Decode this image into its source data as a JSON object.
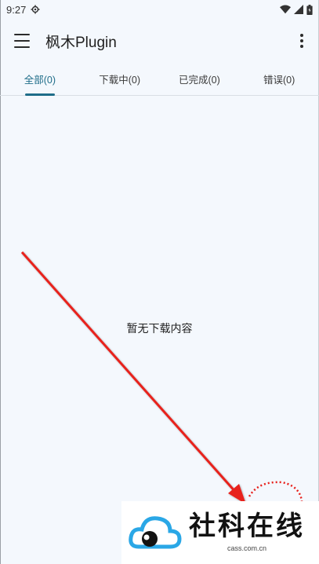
{
  "status_bar": {
    "time": "9:27",
    "icons": [
      "gear-icon",
      "wifi-icon",
      "signal-icon",
      "battery-icon"
    ]
  },
  "app_bar": {
    "title": "枫木Plugin",
    "menu_icon": "hamburger-menu-icon",
    "more_icon": "more-vertical-icon"
  },
  "tabs": [
    {
      "label": "全部(0)",
      "active": true
    },
    {
      "label": "下载中(0)",
      "active": false
    },
    {
      "label": "已完成(0)",
      "active": false
    },
    {
      "label": "错误(0)",
      "active": false
    }
  ],
  "main": {
    "empty_message": "暂无下载内容"
  },
  "annotation": {
    "arrow_color": "#e8201c",
    "circle_color": "#e8201c"
  },
  "watermark": {
    "text": "社科在线",
    "subtext": "cass.com.cn",
    "logo_color": "#2aa7e6"
  },
  "colors": {
    "accent": "#1f6d89",
    "background": "#f4f8fd"
  }
}
